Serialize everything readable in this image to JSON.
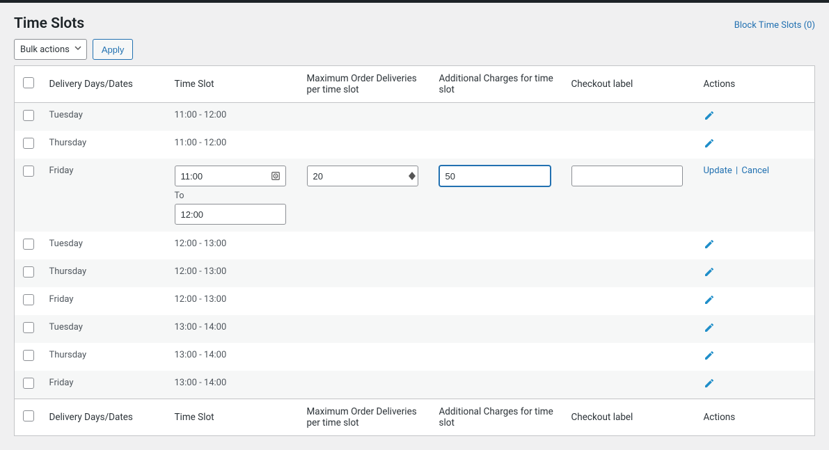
{
  "title": "Time Slots",
  "block_link": "Block Time Slots (0)",
  "toolbar": {
    "bulk_label": "Bulk actions",
    "apply_label": "Apply"
  },
  "columns": {
    "day": "Delivery Days/Dates",
    "slot": "Time Slot",
    "max": "Maximum Order Deliveries per time slot",
    "charge": "Additional Charges for time slot",
    "label": "Checkout label",
    "actions": "Actions"
  },
  "edit_labels": {
    "to": "To",
    "update": "Update",
    "cancel": "Cancel"
  },
  "rows": [
    {
      "day": "Tuesday",
      "slot": "11:00 - 12:00"
    },
    {
      "day": "Thursday",
      "slot": "11:00 - 12:00"
    },
    {
      "day": "Friday",
      "editing": true,
      "from": "11:00",
      "to_val": "12:00",
      "max": "20",
      "charge": "50",
      "label": ""
    },
    {
      "day": "Tuesday",
      "slot": "12:00 - 13:00"
    },
    {
      "day": "Thursday",
      "slot": "12:00 - 13:00"
    },
    {
      "day": "Friday",
      "slot": "12:00 - 13:00"
    },
    {
      "day": "Tuesday",
      "slot": "13:00 - 14:00"
    },
    {
      "day": "Thursday",
      "slot": "13:00 - 14:00"
    },
    {
      "day": "Friday",
      "slot": "13:00 - 14:00"
    }
  ]
}
